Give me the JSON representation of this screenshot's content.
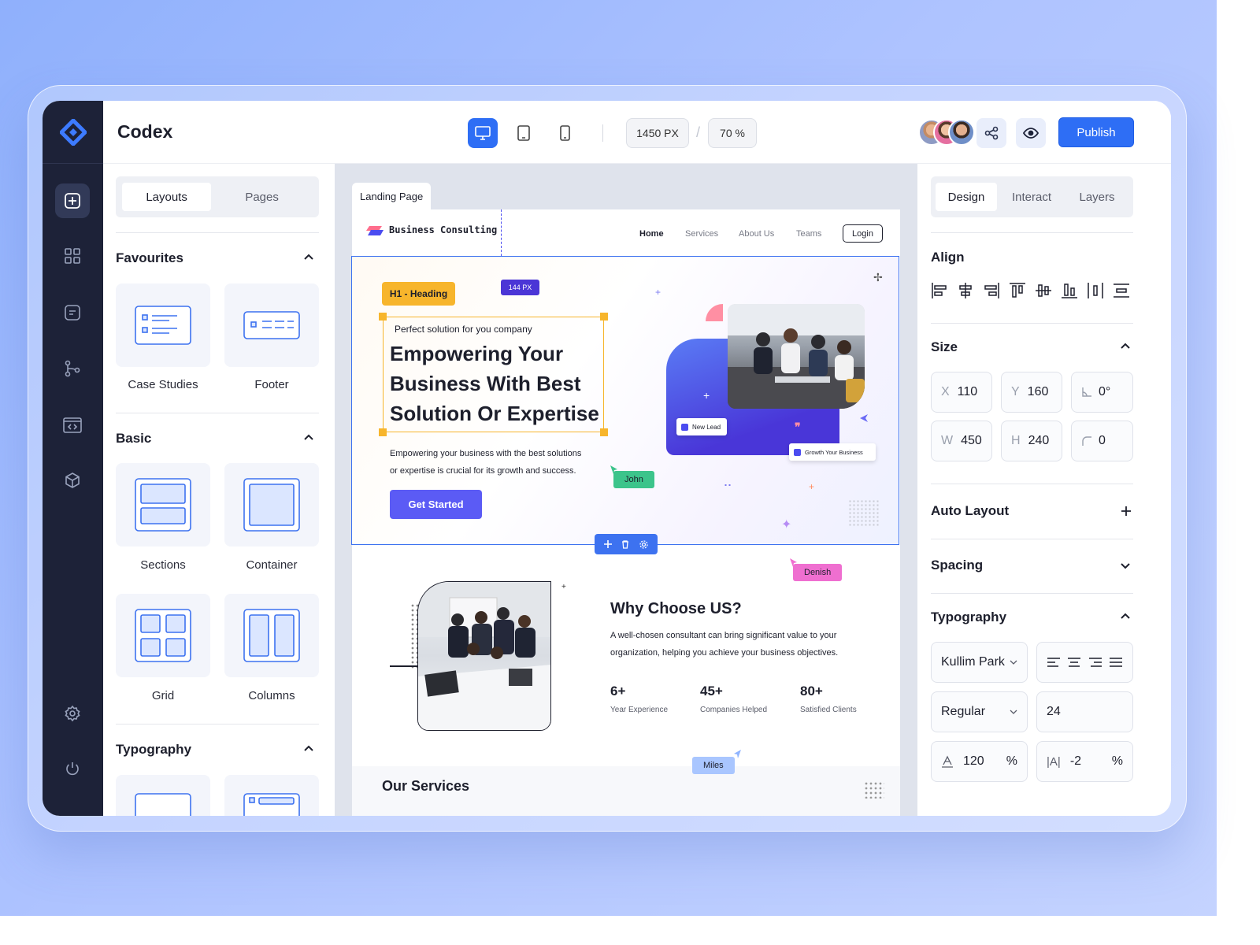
{
  "app": {
    "title": "Codex"
  },
  "toolbar": {
    "width_value": "1450 PX",
    "zoom_value": "70 %",
    "publish_label": "Publish"
  },
  "left_panel": {
    "tabs": [
      "Layouts",
      "Pages"
    ],
    "favourites": {
      "title": "Favourites",
      "items": [
        "Case Studies",
        "Footer"
      ]
    },
    "basic": {
      "title": "Basic",
      "items": [
        "Sections",
        "Container",
        "Grid",
        "Columns"
      ]
    },
    "typography": {
      "title": "Typography"
    }
  },
  "canvas": {
    "page_tab": "Landing Page",
    "spacing_tag": "144 PX",
    "selection_tag": "H1 - Heading",
    "cursors": [
      "John",
      "Denish",
      "Miles"
    ]
  },
  "site": {
    "brand": "Business Consulting",
    "nav": [
      "Home",
      "Services",
      "About Us",
      "Teams"
    ],
    "login": "Login",
    "hero": {
      "kicker": "Perfect solution for you company",
      "heading_lines": [
        "Empowering Your",
        "Business With Best",
        "Solution Or Expertise"
      ],
      "body_lines": [
        "Empowering your business with the best solutions",
        "or expertise is crucial for its growth and success."
      ],
      "cta": "Get Started",
      "card_new_lead": "New Lead",
      "card_growth": "Growth Your Business"
    },
    "why": {
      "title": "Why Choose US?",
      "body_lines": [
        "A well-chosen consultant can bring significant value to your",
        "organization, helping you achieve your business objectives."
      ],
      "stats": [
        {
          "value": "6+",
          "label": "Year Experience"
        },
        {
          "value": "45+",
          "label": "Companies Helped"
        },
        {
          "value": "80+",
          "label": "Satisfied Clients"
        }
      ]
    },
    "services_title": "Our Services"
  },
  "right_panel": {
    "tabs": [
      "Design",
      "Interact",
      "Layers"
    ],
    "align_title": "Align",
    "size": {
      "title": "Size",
      "x": {
        "key": "X",
        "value": "110"
      },
      "y": {
        "key": "Y",
        "value": "160"
      },
      "rotation": "0°",
      "w": {
        "key": "W",
        "value": "450"
      },
      "h": {
        "key": "H",
        "value": "240"
      },
      "radius": "0"
    },
    "auto_layout": "Auto Layout",
    "spacing": "Spacing",
    "typography": {
      "title": "Typography",
      "font": "Kullim Park",
      "weight": "Regular",
      "size": "24",
      "line_height": "120",
      "letter_spacing": "-2",
      "unit": "%"
    }
  },
  "colors": {
    "accent": "#2e6ef5",
    "rail": "#1d2238",
    "selection": "#f7b52c",
    "cta": "#5b5bf5"
  }
}
